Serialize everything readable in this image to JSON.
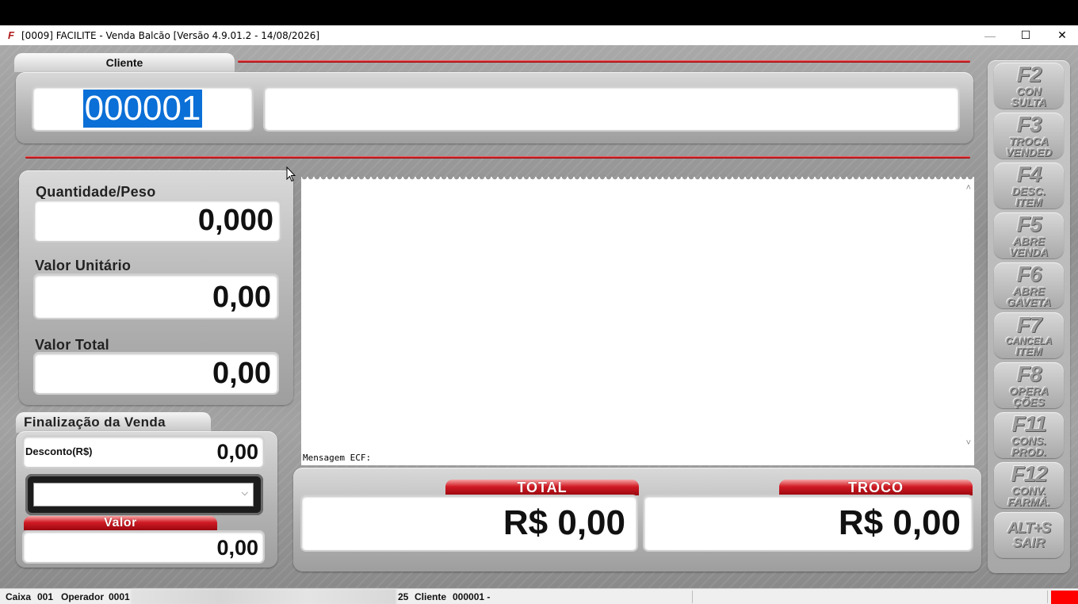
{
  "window": {
    "title": "[0009] FACILITE - Venda Balcão [Versão 4.9.01.2 - 14/08/2026]",
    "app_icon": "facilite-logo-icon",
    "controls": {
      "minimize": "—",
      "maximize": "☐",
      "close": "✕"
    }
  },
  "cliente": {
    "tab_label": "Cliente",
    "code": "000001",
    "name": ""
  },
  "item_entry": {
    "quantity_label": "Quantidade/Peso",
    "quantity_value": "0,000",
    "unit_price_label": "Valor Unitário",
    "unit_price_value": "0,00",
    "total_label": "Valor Total",
    "total_value": "0,00"
  },
  "finalizacao": {
    "tab_label": "Finalização da Venda",
    "discount_label": "Desconto(R$)",
    "discount_value": "0,00",
    "payment_selected": "",
    "valor_label": "Valor",
    "valor_value": "0,00"
  },
  "item_list": {
    "ecf_message_label": "Mensagem ECF:"
  },
  "totals": {
    "total_label": "TOTAL",
    "total_value": "R$ 0,00",
    "troco_label": "TROCO",
    "troco_value": "R$ 0,00"
  },
  "function_keys": [
    {
      "key": "F2",
      "line1": "CON",
      "line2": "SULTA"
    },
    {
      "key": "F3",
      "line1": "TROCA",
      "line2": "VENDED"
    },
    {
      "key": "F4",
      "line1": "DESC.",
      "line2": "ITEM"
    },
    {
      "key": "F5",
      "line1": "ABRE",
      "line2": "VENDA"
    },
    {
      "key": "F6",
      "line1": "ABRE",
      "line2": "GAVETA"
    },
    {
      "key": "F7",
      "line1": "CANCELA",
      "line2": "ITEM"
    },
    {
      "key": "F8",
      "line1": "OPERA",
      "line2": "ÇÕES"
    },
    {
      "key": "F11",
      "line1": "CONS.",
      "line2": "PROD."
    },
    {
      "key": "F12",
      "line1": "CONV.",
      "line2": "FARMÁ."
    },
    {
      "key": "ALT+S",
      "line1": "SAIR",
      "line2": ""
    }
  ],
  "statusbar": {
    "caixa_label": "Caixa",
    "caixa_value": "001",
    "operador_label": "Operador",
    "operador_value": "0001",
    "partial_value": "25",
    "cliente_label": "Cliente",
    "cliente_value": "000001 -",
    "indicator_color": "#ff0000"
  }
}
